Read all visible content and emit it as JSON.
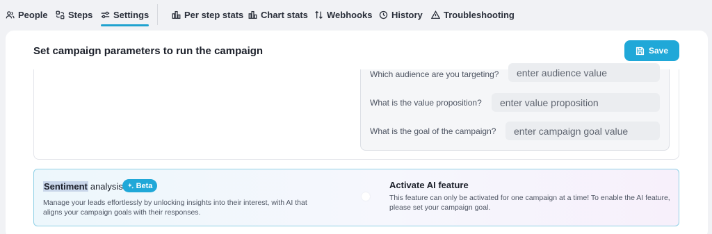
{
  "nav": {
    "people": "People",
    "steps": "Steps",
    "settings": "Settings",
    "per_step_stats": "Per step stats",
    "chart_stats": "Chart stats",
    "webhooks": "Webhooks",
    "history": "History",
    "troubleshooting": "Troubleshooting",
    "active_tab": "Settings",
    "accent_color": "#1fa2cf"
  },
  "header": {
    "title": "Set campaign parameters to run the campaign",
    "save_label": "Save"
  },
  "params": [
    {
      "label": "Which audience are you targeting?",
      "placeholder": "enter audience value"
    },
    {
      "label": "What is the value proposition?",
      "placeholder": "enter value proposition"
    },
    {
      "label": "What is the goal of the campaign?",
      "placeholder": "enter campaign goal value"
    }
  ],
  "sentiment": {
    "title_highlight": "Sentiment",
    "title_rest": "analysis",
    "badge": "Beta",
    "description": "Manage your leads effortlessly by unlocking insights into their interest, with AI that aligns your campaign goals with their responses.",
    "toggle_on": false
  },
  "ai_feature": {
    "title": "Activate AI feature",
    "description": "This feature can only be activated for one campaign at a time! To enable the AI feature, please set your campaign goal."
  },
  "colors": {
    "primary": "#20a8d8",
    "background": "#f1f2f5"
  }
}
